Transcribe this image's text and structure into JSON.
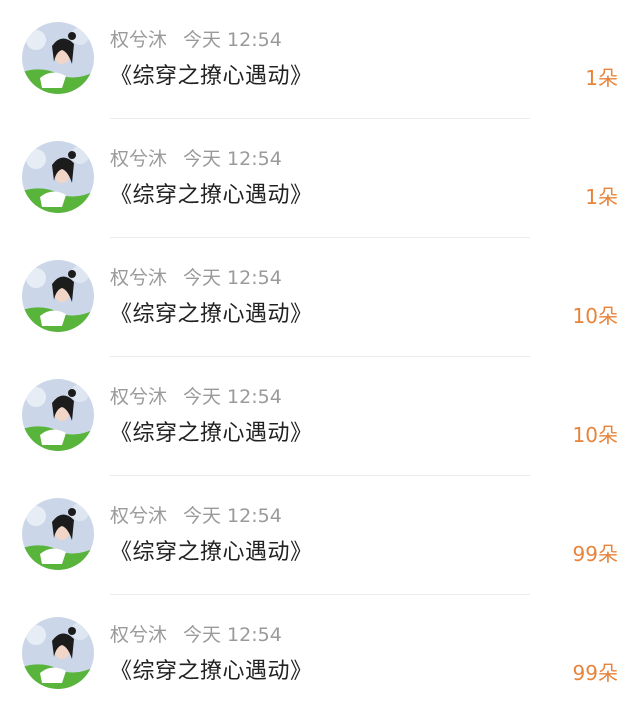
{
  "items": [
    {
      "user": "权兮沐",
      "time": "今天 12:54",
      "title": "《综穿之撩心遇动》",
      "amount": "1朵"
    },
    {
      "user": "权兮沐",
      "time": "今天 12:54",
      "title": "《综穿之撩心遇动》",
      "amount": "1朵"
    },
    {
      "user": "权兮沐",
      "time": "今天 12:54",
      "title": "《综穿之撩心遇动》",
      "amount": "10朵"
    },
    {
      "user": "权兮沐",
      "time": "今天 12:54",
      "title": "《综穿之撩心遇动》",
      "amount": "10朵"
    },
    {
      "user": "权兮沐",
      "time": "今天 12:54",
      "title": "《综穿之撩心遇动》",
      "amount": "99朵"
    },
    {
      "user": "权兮沐",
      "time": "今天 12:54",
      "title": "《综穿之撩心遇动》",
      "amount": "99朵"
    }
  ],
  "colors": {
    "amount": "#e8833a",
    "meta": "#9a9a9a",
    "title": "#222222"
  },
  "icons": {
    "avatar": "user-avatar-photo"
  }
}
